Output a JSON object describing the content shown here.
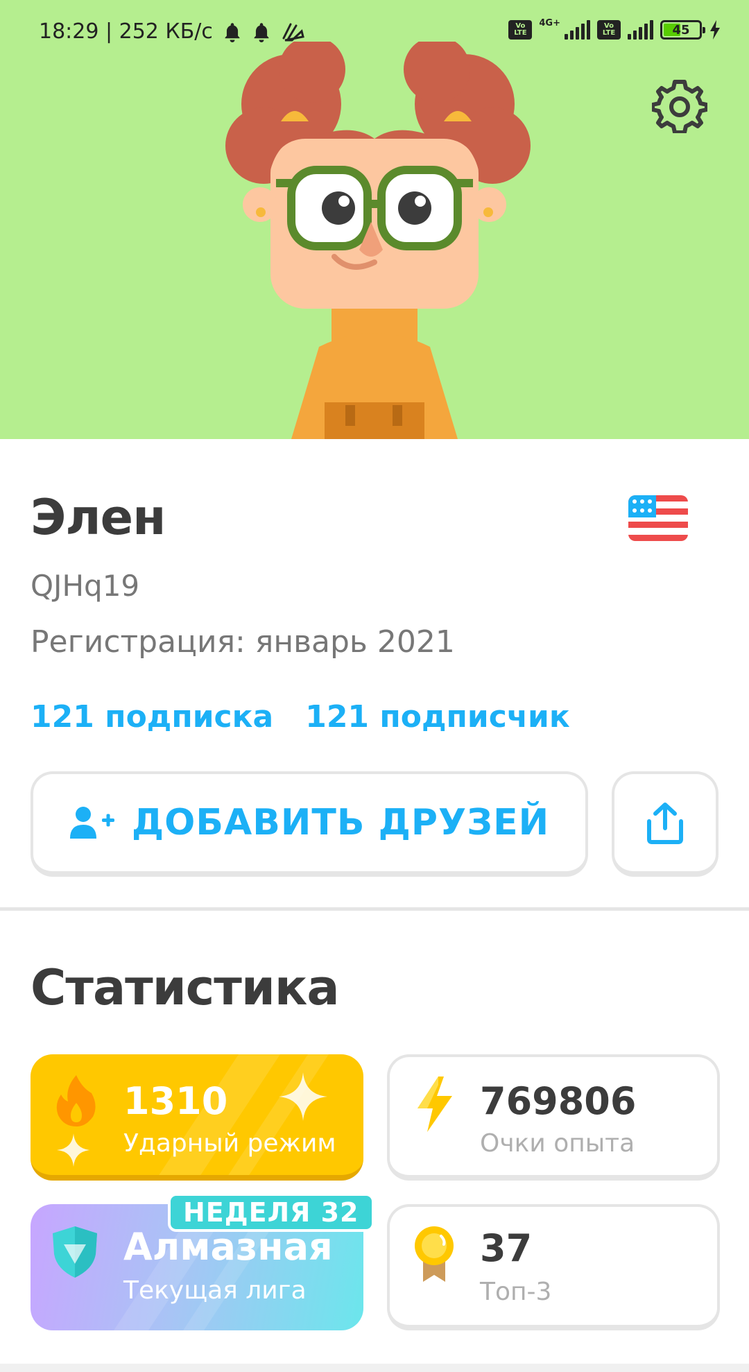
{
  "status_bar": {
    "time_speed": "18:29 | 252 КБ/с",
    "network": "4G+",
    "volte": "Vo LTE",
    "battery": "45"
  },
  "profile": {
    "name": "Элен",
    "username": "QJHq19",
    "joined": "Регистрация: январь 2021",
    "following": "121 подписка",
    "followers": "121 подписчик",
    "add_friends_label": "ДОБАВИТЬ ДРУЗЕЙ",
    "language_flag": "us-flag-icon"
  },
  "stats": {
    "title": "Статистика",
    "streak": {
      "value": "1310",
      "label": "Ударный режим",
      "icon": "fire-icon"
    },
    "xp": {
      "value": "769806",
      "label": "Очки опыта",
      "icon": "lightning-icon"
    },
    "league": {
      "value": "Алмазная",
      "label": "Текущая лига",
      "badge": "НЕДЕЛЯ 32",
      "icon": "diamond-shield-icon"
    },
    "top3": {
      "value": "37",
      "label": "Топ-3",
      "icon": "medal-icon"
    }
  },
  "colors": {
    "hero_bg": "#b5ee8f",
    "accent_blue": "#1cb0f6",
    "streak_gold": "#ffc800",
    "text_dark": "#3c3c3c",
    "text_grey": "#777777"
  }
}
